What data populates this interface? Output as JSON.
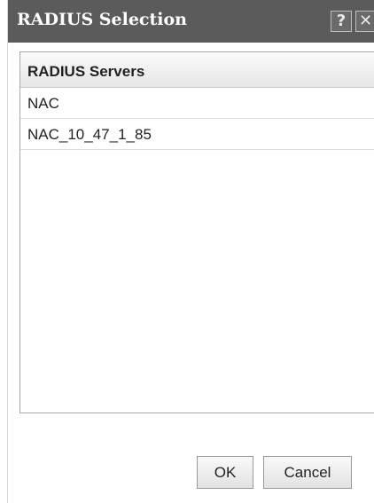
{
  "dialog": {
    "title": "RADIUS Selection",
    "help_label": "?",
    "close_label": "✕"
  },
  "list": {
    "header": "RADIUS Servers",
    "items": [
      {
        "label": "NAC"
      },
      {
        "label": "NAC_10_47_1_85"
      }
    ]
  },
  "footer": {
    "ok_label": "OK",
    "cancel_label": "Cancel"
  },
  "colors": {
    "titlebar": "#5b5b5b",
    "title_text": "#ffffff"
  }
}
